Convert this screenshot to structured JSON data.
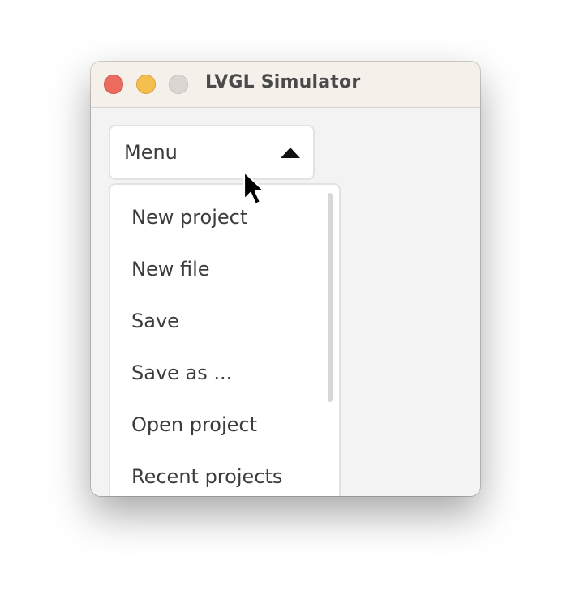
{
  "window": {
    "title": "LVGL Simulator"
  },
  "dropdown": {
    "label": "Menu",
    "state": "open"
  },
  "menu": {
    "items": [
      {
        "label": "New project"
      },
      {
        "label": "New file"
      },
      {
        "label": "Save"
      },
      {
        "label": "Save as ..."
      },
      {
        "label": "Open project"
      },
      {
        "label": "Recent projects"
      }
    ]
  },
  "colors": {
    "close": "#ec6a5e",
    "minimize": "#f5bf4f",
    "maximize_disabled": "#dad6d2",
    "titlebar": "#f6f0eb",
    "background": "#f3f3f3",
    "text": "#3c3c3c"
  }
}
